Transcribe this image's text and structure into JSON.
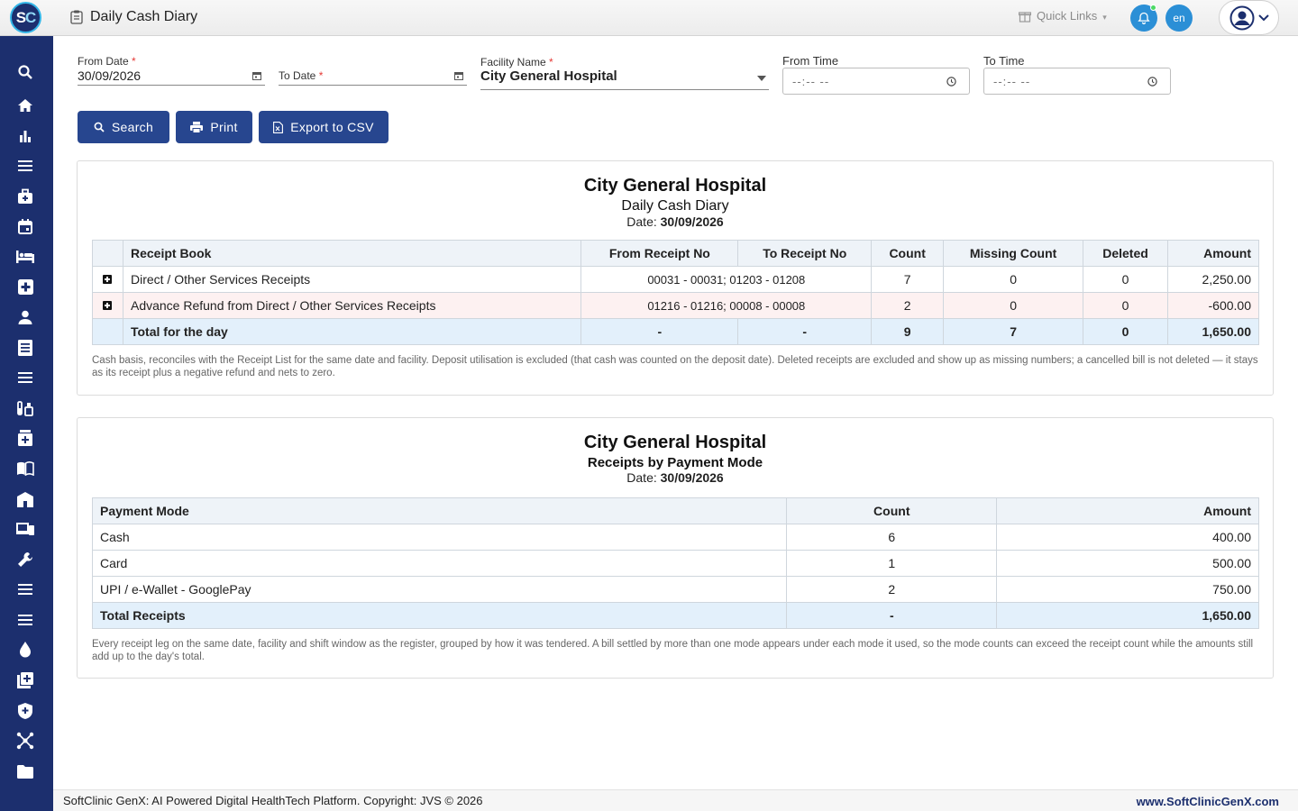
{
  "app": {
    "logo_text": "SC",
    "page_title": "Daily Cash Diary"
  },
  "topbar": {
    "quick_links": "Quick Links",
    "language": "en"
  },
  "filters": {
    "from_date_label": "From Date",
    "from_date_value": "30/09/2026",
    "to_date_label": "To Date",
    "to_date_value": "",
    "facility_label": "Facility Name",
    "facility_value": "City General Hospital",
    "from_time_label": "From Time",
    "from_time_value": "--:-- --",
    "to_time_label": "To Time",
    "to_time_value": "--:-- --",
    "required_mark": "*"
  },
  "buttons": {
    "search": "Search",
    "print": "Print",
    "export": "Export to CSV"
  },
  "cash_diary": {
    "facility": "City General Hospital",
    "title": "Daily Cash Diary",
    "date_label": "Date:",
    "date": "30/09/2026",
    "columns": [
      "Receipt Book",
      "From Receipt No",
      "To Receipt No",
      "Count",
      "Missing Count",
      "Deleted",
      "Amount"
    ],
    "rows": [
      {
        "book": "Direct / Other Services Receipts",
        "range": "00031 - 00031; 01203 - 01208",
        "count": "7",
        "missing": "0",
        "deleted": "0",
        "amount": "2,250.00"
      },
      {
        "book": "Advance Refund from Direct / Other Services Receipts",
        "range": "01216 - 01216; 00008 - 00008",
        "count": "2",
        "missing": "0",
        "deleted": "0",
        "amount": "-600.00"
      }
    ],
    "total": {
      "label": "Total for the day",
      "from": "-",
      "to": "-",
      "count": "9",
      "missing": "7",
      "deleted": "0",
      "amount": "1,650.00"
    },
    "note": "Cash basis, reconciles with the Receipt List for the same date and facility. Deposit utilisation is excluded (that cash was counted on the deposit date). Deleted receipts are excluded and show up as missing numbers; a cancelled bill is not deleted — it stays as its receipt plus a negative refund and nets to zero."
  },
  "payment_mode": {
    "facility": "City General Hospital",
    "title": "Receipts by Payment Mode",
    "date_label": "Date:",
    "date": "30/09/2026",
    "columns": [
      "Payment Mode",
      "Count",
      "Amount"
    ],
    "rows": [
      {
        "mode": "Cash",
        "count": "6",
        "amount": "400.00"
      },
      {
        "mode": "Card",
        "count": "1",
        "amount": "500.00"
      },
      {
        "mode": "UPI / e-Wallet - GooglePay",
        "count": "2",
        "amount": "750.00"
      }
    ],
    "total": {
      "label": "Total Receipts",
      "count": "-",
      "amount": "1,650.00"
    },
    "note": "Every receipt leg on the same date, facility and shift window as the register, grouped by how it was tendered. A bill settled by more than one mode appears under each mode it used, so the mode counts can exceed the receipt count while the amounts still add up to the day's total."
  },
  "footer": {
    "left": "SoftClinic GenX: AI Powered Digital HealthTech Platform. Copyright: JVS © 2026",
    "right": "www.SoftClinicGenX.com"
  },
  "sidebar_icons": [
    "search-icon",
    "home-icon",
    "bar-chart-icon",
    "menu-icon",
    "medical-bag-icon",
    "calendar-icon",
    "bed-icon",
    "add-box-icon",
    "person-icon",
    "receipt-icon",
    "list-icon",
    "lab-icon",
    "pharmacy-icon",
    "book-icon",
    "building-icon",
    "devices-icon",
    "wrench-icon",
    "menu-icon",
    "menu-icon",
    "drop-icon",
    "add-library-icon",
    "shield-icon",
    "network-icon",
    "folder-icon"
  ]
}
